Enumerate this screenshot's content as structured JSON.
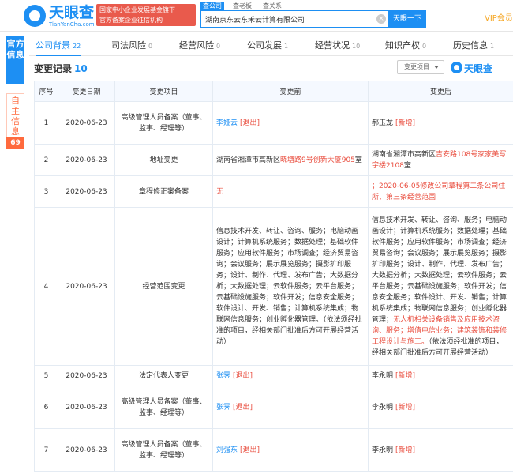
{
  "header": {
    "logo_text": "天眼查",
    "logo_url": "TianYanCha.com",
    "banner_line1": "国家中小企业发展基金旗下",
    "banner_line2": "官方备案企业征信机构",
    "search_tabs": [
      "查公司",
      "查老板",
      "查关系"
    ],
    "search_value": "湖南京东云东禾云计算有限公司",
    "search_clear": "×",
    "search_button": "天眼一下",
    "vip": "VIP会员"
  },
  "sidebar": {
    "official": "官方信息",
    "self": "自主信息",
    "self_count": "69"
  },
  "tabs": [
    {
      "label": "公司背景",
      "count": "22",
      "active": true
    },
    {
      "label": "司法风险",
      "count": "0"
    },
    {
      "label": "经营风险",
      "count": "0"
    },
    {
      "label": "公司发展",
      "count": "1"
    },
    {
      "label": "经营状况",
      "count": "10"
    },
    {
      "label": "知识产权",
      "count": "0"
    },
    {
      "label": "历史信息",
      "count": "1"
    }
  ],
  "section": {
    "title": "变更记录",
    "count": "10",
    "filter_label": "变更项目",
    "brand": "天眼查"
  },
  "table": {
    "headers": [
      "序号",
      "变更日期",
      "变更项目",
      "变更前",
      "变更后"
    ],
    "rows": [
      {
        "no": "1",
        "date": "2020-06-23",
        "item": "高级管理人员备案（董事、监事、经理等）",
        "before_name": "李娅云",
        "before_tag": "[退出]",
        "after_name": "郝玉龙",
        "after_tag": "[新增]"
      },
      {
        "no": "2",
        "date": "2020-06-23",
        "item": "地址变更",
        "before_p1": "湖南省湘潭市高新区",
        "before_p2": "晓塘路9号创新大厦905",
        "before_p3": "室",
        "after_p1": "湖南省湘潭市高新区",
        "after_p2": "吉安路108号家家美写字楼2108",
        "after_p3": "室"
      },
      {
        "no": "3",
        "date": "2020-06-23",
        "item": "章程修正案备案",
        "before": "无",
        "after": "；2020-06-05修改公司章程第二条公司住所、第三条经营范围"
      },
      {
        "no": "4",
        "date": "2020-06-23",
        "item": "经营范围变更",
        "before": "信息技术开发、转让、咨询、服务；电脑动画设计；计算机系统服务；数据处理；基础软件服务；应用软件服务；市场调查；经济贸易咨询；会议服务；展示展览服务；摄影扩印服务；设计、制作、代理、发布广告；大数据分析；大数据处理；云软件服务；云平台服务；云基础设施服务；软件开发；信息安全服务；软件设计、开发、销售；计算机系统集成；物联网信息服务；创业孵化器管理。（依法须经批准的项目，经相关部门批准后方可开展经营活动）",
        "after_main": "信息技术开发、转让、咨询、服务；电脑动画设计；计算机系统服务；数据处理；基础软件服务；应用软件服务；市场调查；经济贸易咨询；会议服务；展示展览服务；摄影扩印服务；设计、制作、代理、发布广告；大数据分析；大数据处理；云软件服务；云平台服务；云基础设施服务；软件开发；信息安全服务；软件设计、开发、销售；计算机系统集成；物联网信息服务；创业孵化器管理；",
        "after_red": "无人机相关设备销售及应用技术咨询、服务；增值电信业务；建筑装饰和装修工程设计与施工。",
        "after_tail": "（依法须经批准的项目，经相关部门批准后方可开展经营活动）"
      },
      {
        "no": "5",
        "date": "2020-06-23",
        "item": "法定代表人变更",
        "before_name": "张霁",
        "before_tag": "[退出]",
        "after_name": "李永明",
        "after_tag": "[新增]"
      },
      {
        "no": "6",
        "date": "2020-06-23",
        "item": "高级管理人员备案（董事、监事、经理等）",
        "before_name": "张霁",
        "before_tag": "[退出]",
        "after_name": "李永明",
        "after_tag": "[新增]"
      },
      {
        "no": "7",
        "date": "2020-06-23",
        "item": "高级管理人员备案（董事、监事、经理等）",
        "before_name": "刘强东",
        "before_tag": "[退出]",
        "after_name": "李永明",
        "after_tag": "[新增]"
      }
    ]
  }
}
